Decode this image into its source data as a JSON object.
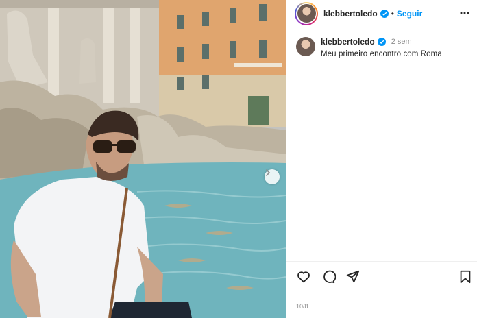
{
  "post": {
    "username": "klebbertoledo",
    "follow_label": "Seguir",
    "separator": "•",
    "verified": true,
    "caption": "Meu primeiro encontro com Roma",
    "time_ago": "2 sem",
    "date": "10/8"
  },
  "icons": {
    "carousel_next": "chevron-right-icon",
    "more": "more-horizontal-icon",
    "like": "heart-icon",
    "comment": "comment-icon",
    "share": "share-icon",
    "save": "bookmark-icon",
    "verified": "verified-badge-icon"
  },
  "colors": {
    "follow_blue": "#0095f6",
    "verified_blue": "#0095f6",
    "text": "#262626",
    "muted": "#8e8e8e"
  }
}
